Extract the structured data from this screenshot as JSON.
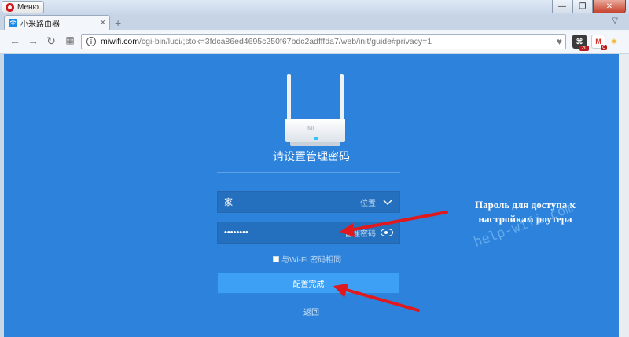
{
  "browser": {
    "menu_label": "Меню",
    "window_buttons": [
      "—",
      "❐",
      "✕"
    ],
    "tab": {
      "label": "小米路由器",
      "close": "×"
    },
    "new_tab": "+",
    "tab_menu": "▽",
    "url_host": "miwifi.com",
    "url_path": "/cgi-bin/luci/;stok=3fdca86ed4695c250f67bdc2adfffda7/web/init/guide#privacy=1",
    "extensions": [
      {
        "name": "extension-1",
        "badge": "20"
      },
      {
        "name": "gmail-extension",
        "label": "M",
        "badge": "0"
      },
      {
        "name": "weather-extension"
      }
    ]
  },
  "page": {
    "title": "请设置管理密码",
    "location_field": {
      "value": "家",
      "hint": "位置"
    },
    "password_field": {
      "value": "••••••••",
      "hint": "管理密码"
    },
    "same_as_wifi_label": "与Wi-Fi 密码相同",
    "submit_label": "配置完成",
    "back_label": "返回",
    "router_logo": "MI"
  },
  "annotation": {
    "text_line1": "Пароль для доступа к",
    "text_line2": "настройкам роутера",
    "watermark": "help-wifi.com",
    "arrow_color": "#e0191e"
  }
}
